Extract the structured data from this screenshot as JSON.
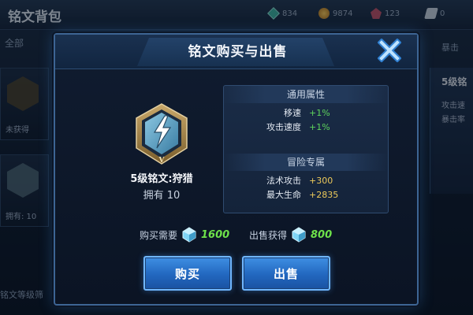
{
  "background": {
    "title": "铭文背包",
    "resources": [
      "834",
      "9874",
      "123",
      "0"
    ],
    "tab_all": "全部",
    "tab_right": "暴击",
    "slot1_text": "未获得",
    "slot2_text": "拥有: 10",
    "right_card": {
      "title": "5级铭",
      "line1": "攻击速",
      "line2": "暴击率"
    },
    "bottom_text": "铭文等级筛"
  },
  "modal": {
    "title": "铭文购买与出售",
    "rune": {
      "name": "5级铭文:狩猎",
      "owned": "拥有 10",
      "emblem_letter": "V"
    },
    "common_attributes": {
      "header": "通用属性",
      "rows": [
        {
          "key": "移速",
          "value": "+1%"
        },
        {
          "key": "攻击速度",
          "value": "+1%"
        }
      ]
    },
    "adventure_attributes": {
      "header": "冒险专属",
      "rows": [
        {
          "key": "法术攻击",
          "value": "+300"
        },
        {
          "key": "最大生命",
          "value": "+2835"
        }
      ]
    },
    "price": {
      "buy_label": "购买需要",
      "buy_value": "1600",
      "sell_label": "出售获得",
      "sell_value": "800"
    },
    "buttons": {
      "buy": "购买",
      "sell": "出售"
    }
  },
  "colors": {
    "accent": "#3f8fe3",
    "positive": "#5ed45c",
    "highlight": "#ecc95a"
  }
}
